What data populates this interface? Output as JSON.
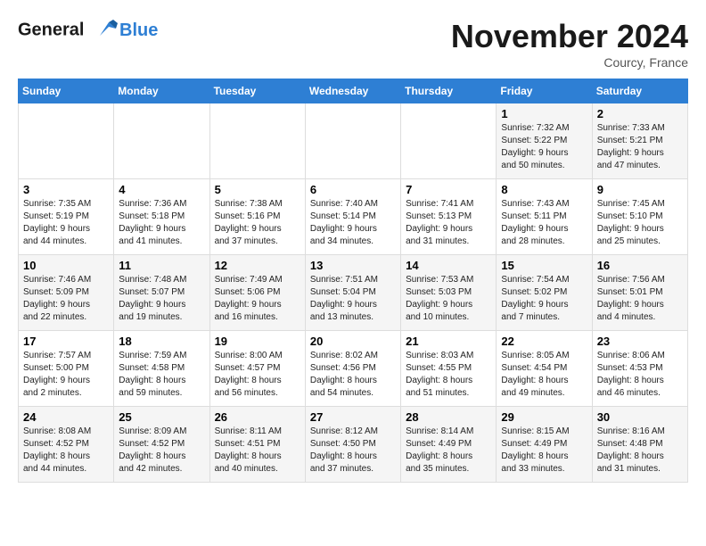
{
  "logo": {
    "line1": "General",
    "line2": "Blue"
  },
  "title": "November 2024",
  "location": "Courcy, France",
  "days_header": [
    "Sunday",
    "Monday",
    "Tuesday",
    "Wednesday",
    "Thursday",
    "Friday",
    "Saturday"
  ],
  "weeks": [
    [
      {
        "day": "",
        "info": ""
      },
      {
        "day": "",
        "info": ""
      },
      {
        "day": "",
        "info": ""
      },
      {
        "day": "",
        "info": ""
      },
      {
        "day": "",
        "info": ""
      },
      {
        "day": "1",
        "info": "Sunrise: 7:32 AM\nSunset: 5:22 PM\nDaylight: 9 hours\nand 50 minutes."
      },
      {
        "day": "2",
        "info": "Sunrise: 7:33 AM\nSunset: 5:21 PM\nDaylight: 9 hours\nand 47 minutes."
      }
    ],
    [
      {
        "day": "3",
        "info": "Sunrise: 7:35 AM\nSunset: 5:19 PM\nDaylight: 9 hours\nand 44 minutes."
      },
      {
        "day": "4",
        "info": "Sunrise: 7:36 AM\nSunset: 5:18 PM\nDaylight: 9 hours\nand 41 minutes."
      },
      {
        "day": "5",
        "info": "Sunrise: 7:38 AM\nSunset: 5:16 PM\nDaylight: 9 hours\nand 37 minutes."
      },
      {
        "day": "6",
        "info": "Sunrise: 7:40 AM\nSunset: 5:14 PM\nDaylight: 9 hours\nand 34 minutes."
      },
      {
        "day": "7",
        "info": "Sunrise: 7:41 AM\nSunset: 5:13 PM\nDaylight: 9 hours\nand 31 minutes."
      },
      {
        "day": "8",
        "info": "Sunrise: 7:43 AM\nSunset: 5:11 PM\nDaylight: 9 hours\nand 28 minutes."
      },
      {
        "day": "9",
        "info": "Sunrise: 7:45 AM\nSunset: 5:10 PM\nDaylight: 9 hours\nand 25 minutes."
      }
    ],
    [
      {
        "day": "10",
        "info": "Sunrise: 7:46 AM\nSunset: 5:09 PM\nDaylight: 9 hours\nand 22 minutes."
      },
      {
        "day": "11",
        "info": "Sunrise: 7:48 AM\nSunset: 5:07 PM\nDaylight: 9 hours\nand 19 minutes."
      },
      {
        "day": "12",
        "info": "Sunrise: 7:49 AM\nSunset: 5:06 PM\nDaylight: 9 hours\nand 16 minutes."
      },
      {
        "day": "13",
        "info": "Sunrise: 7:51 AM\nSunset: 5:04 PM\nDaylight: 9 hours\nand 13 minutes."
      },
      {
        "day": "14",
        "info": "Sunrise: 7:53 AM\nSunset: 5:03 PM\nDaylight: 9 hours\nand 10 minutes."
      },
      {
        "day": "15",
        "info": "Sunrise: 7:54 AM\nSunset: 5:02 PM\nDaylight: 9 hours\nand 7 minutes."
      },
      {
        "day": "16",
        "info": "Sunrise: 7:56 AM\nSunset: 5:01 PM\nDaylight: 9 hours\nand 4 minutes."
      }
    ],
    [
      {
        "day": "17",
        "info": "Sunrise: 7:57 AM\nSunset: 5:00 PM\nDaylight: 9 hours\nand 2 minutes."
      },
      {
        "day": "18",
        "info": "Sunrise: 7:59 AM\nSunset: 4:58 PM\nDaylight: 8 hours\nand 59 minutes."
      },
      {
        "day": "19",
        "info": "Sunrise: 8:00 AM\nSunset: 4:57 PM\nDaylight: 8 hours\nand 56 minutes."
      },
      {
        "day": "20",
        "info": "Sunrise: 8:02 AM\nSunset: 4:56 PM\nDaylight: 8 hours\nand 54 minutes."
      },
      {
        "day": "21",
        "info": "Sunrise: 8:03 AM\nSunset: 4:55 PM\nDaylight: 8 hours\nand 51 minutes."
      },
      {
        "day": "22",
        "info": "Sunrise: 8:05 AM\nSunset: 4:54 PM\nDaylight: 8 hours\nand 49 minutes."
      },
      {
        "day": "23",
        "info": "Sunrise: 8:06 AM\nSunset: 4:53 PM\nDaylight: 8 hours\nand 46 minutes."
      }
    ],
    [
      {
        "day": "24",
        "info": "Sunrise: 8:08 AM\nSunset: 4:52 PM\nDaylight: 8 hours\nand 44 minutes."
      },
      {
        "day": "25",
        "info": "Sunrise: 8:09 AM\nSunset: 4:52 PM\nDaylight: 8 hours\nand 42 minutes."
      },
      {
        "day": "26",
        "info": "Sunrise: 8:11 AM\nSunset: 4:51 PM\nDaylight: 8 hours\nand 40 minutes."
      },
      {
        "day": "27",
        "info": "Sunrise: 8:12 AM\nSunset: 4:50 PM\nDaylight: 8 hours\nand 37 minutes."
      },
      {
        "day": "28",
        "info": "Sunrise: 8:14 AM\nSunset: 4:49 PM\nDaylight: 8 hours\nand 35 minutes."
      },
      {
        "day": "29",
        "info": "Sunrise: 8:15 AM\nSunset: 4:49 PM\nDaylight: 8 hours\nand 33 minutes."
      },
      {
        "day": "30",
        "info": "Sunrise: 8:16 AM\nSunset: 4:48 PM\nDaylight: 8 hours\nand 31 minutes."
      }
    ]
  ]
}
